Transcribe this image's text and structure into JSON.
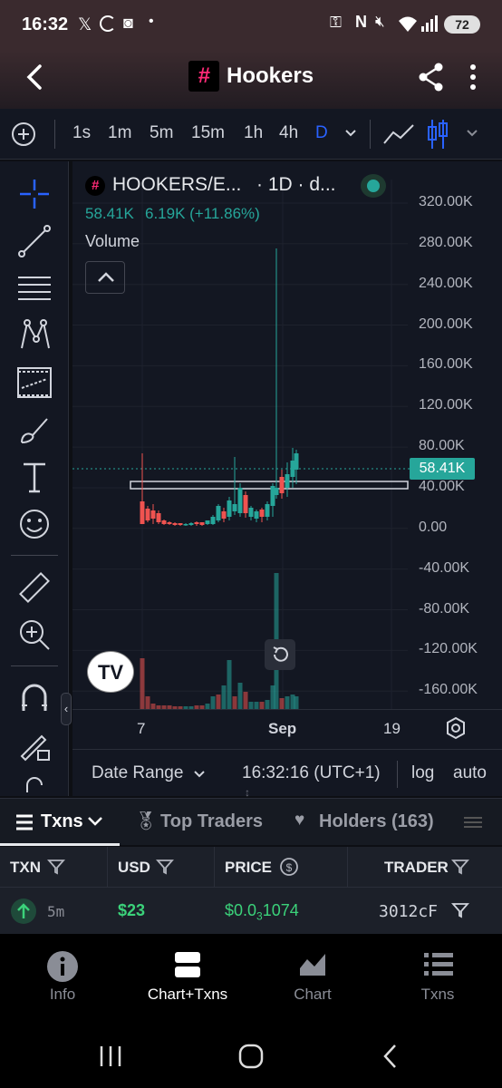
{
  "status": {
    "time": "16:32",
    "battery": "72"
  },
  "app": {
    "title": "Hookers"
  },
  "toolbar": {
    "timeframes": [
      "1s",
      "1m",
      "5m",
      "15m",
      "1h",
      "4h",
      "D"
    ],
    "active": "D"
  },
  "chart": {
    "symbol": "HOOKERS/E...",
    "interval": "· 1D · d...",
    "ohlc": "58.41K",
    "change": "6.19K (+11.86%)",
    "volume_label": "Volume",
    "y_ticks": [
      "320.00K",
      "280.00K",
      "240.00K",
      "200.00K",
      "160.00K",
      "120.00K",
      "80.00K",
      "40.00K",
      "0.00",
      "-40.00K",
      "-80.00K",
      "-120.00K",
      "-160.00K"
    ],
    "price_tag": "58.41K",
    "x_ticks": [
      "7",
      "Sep",
      "19"
    ],
    "date_range": "Date Range",
    "clock": "16:32:16 (UTC+1)",
    "log": "log",
    "auto": "auto",
    "colors": {
      "up": "#26a69a",
      "down": "#ef5350"
    }
  },
  "tabs": {
    "txns": "Txns",
    "top_traders": "Top Traders",
    "holders": "Holders (163)"
  },
  "table": {
    "headers": [
      "TXN",
      "USD",
      "PRICE",
      "TRADER"
    ],
    "row": {
      "age": "5m",
      "usd": "$23",
      "price_prefix": "$0.0",
      "price_sub": "3",
      "price_suffix": "1074",
      "trader": "3012cF"
    }
  },
  "nav": {
    "info": "Info",
    "chart_txns": "Chart+Txns",
    "chart": "Chart",
    "txns": "Txns"
  }
}
